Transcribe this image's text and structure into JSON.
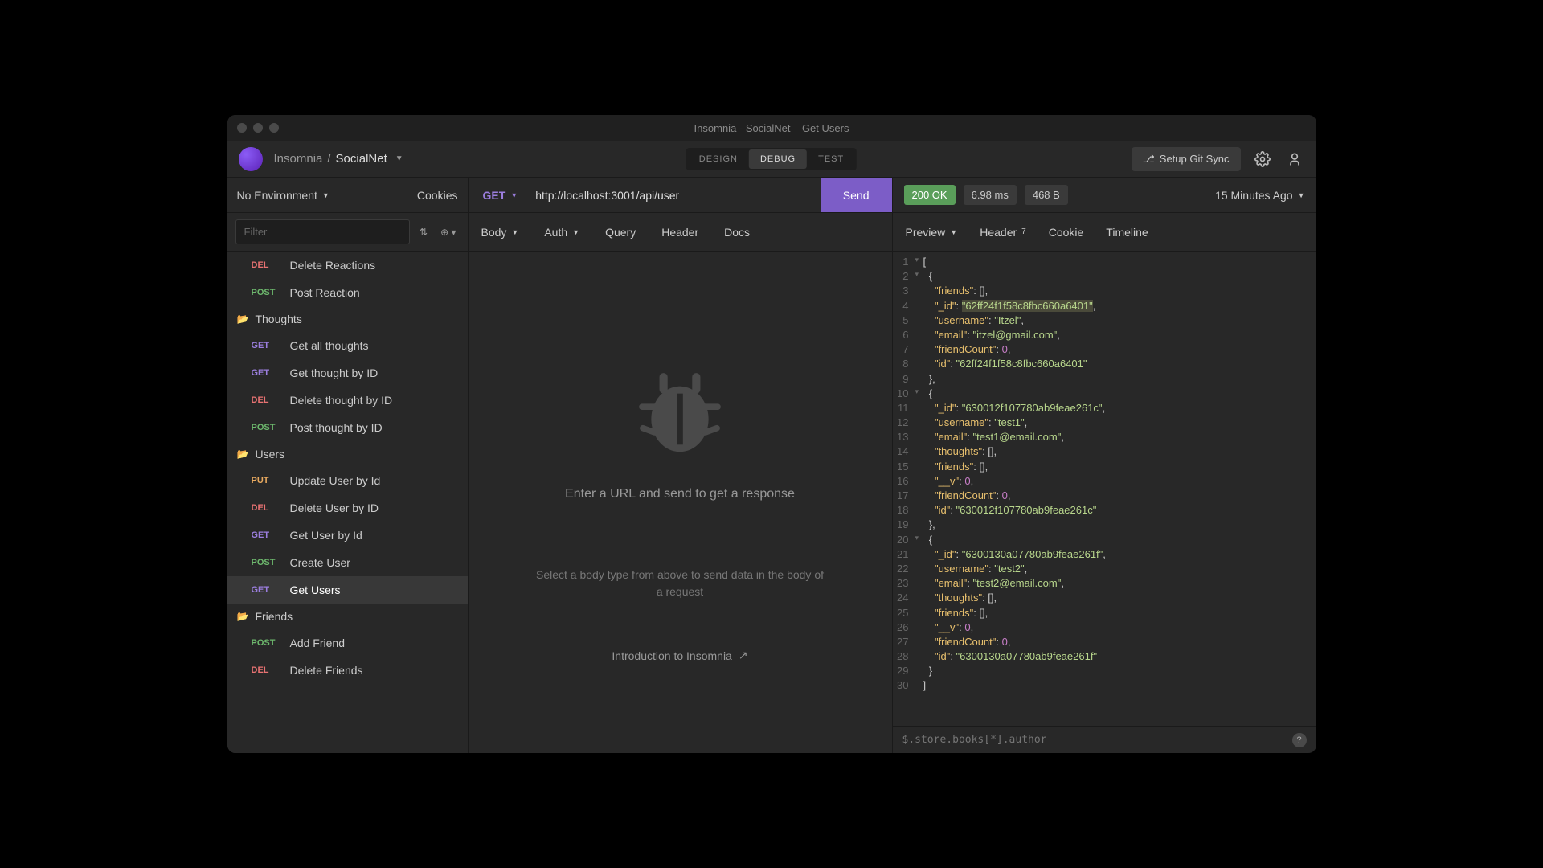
{
  "window_title": "Insomnia - SocialNet – Get Users",
  "breadcrumb": {
    "app": "Insomnia",
    "project": "SocialNet"
  },
  "modes": {
    "design": "DESIGN",
    "debug": "DEBUG",
    "test": "TEST"
  },
  "git_sync": "Setup Git Sync",
  "env_bar": {
    "env": "No Environment",
    "cookies": "Cookies"
  },
  "filter": {
    "placeholder": "Filter"
  },
  "sidebar": {
    "items": [
      {
        "type": "req",
        "method": "DEL",
        "name": "Delete Reactions"
      },
      {
        "type": "req",
        "method": "POST",
        "name": "Post Reaction"
      },
      {
        "type": "folder",
        "name": "Thoughts"
      },
      {
        "type": "req",
        "method": "GET",
        "name": "Get all thoughts"
      },
      {
        "type": "req",
        "method": "GET",
        "name": "Get thought by ID"
      },
      {
        "type": "req",
        "method": "DEL",
        "name": "Delete thought by ID"
      },
      {
        "type": "req",
        "method": "POST",
        "name": "Post thought by ID"
      },
      {
        "type": "folder",
        "name": "Users"
      },
      {
        "type": "req",
        "method": "PUT",
        "name": "Update User by Id"
      },
      {
        "type": "req",
        "method": "DEL",
        "name": "Delete User by ID"
      },
      {
        "type": "req",
        "method": "GET",
        "name": "Get User by Id"
      },
      {
        "type": "req",
        "method": "POST",
        "name": "Create User"
      },
      {
        "type": "req",
        "method": "GET",
        "name": "Get Users",
        "active": true
      },
      {
        "type": "folder",
        "name": "Friends"
      },
      {
        "type": "req",
        "method": "POST",
        "name": "Add Friend"
      },
      {
        "type": "req",
        "method": "DEL",
        "name": "Delete Friends"
      }
    ]
  },
  "request": {
    "method": "GET",
    "url": "http://localhost:3001/api/user",
    "send": "Send",
    "tabs": {
      "body": "Body",
      "auth": "Auth",
      "query": "Query",
      "header": "Header",
      "docs": "Docs"
    },
    "empty_msg": "Enter a URL and send to get a response",
    "body_hint": "Select a body type from above to send data in the body of a request",
    "intro": "Introduction to Insomnia"
  },
  "response": {
    "status": "200 OK",
    "time": "6.98 ms",
    "size": "468 B",
    "age": "15 Minutes Ago",
    "tabs": {
      "preview": "Preview",
      "header": "Header",
      "header_count": "7",
      "cookie": "Cookie",
      "timeline": "Timeline"
    },
    "json_lines": [
      {
        "n": 1,
        "fold": "▾",
        "tokens": [
          [
            "punc",
            "["
          ]
        ]
      },
      {
        "n": 2,
        "fold": "▾",
        "tokens": [
          [
            "punc",
            "  {"
          ]
        ]
      },
      {
        "n": 3,
        "tokens": [
          [
            "pad",
            "    "
          ],
          [
            "key",
            "\"friends\""
          ],
          [
            "punc",
            ": [],"
          ]
        ]
      },
      {
        "n": 4,
        "tokens": [
          [
            "pad",
            "    "
          ],
          [
            "key",
            "\"_id\""
          ],
          [
            "punc",
            ": "
          ],
          [
            "strH",
            "\"62ff24f1f58c8fbc660a6401\""
          ],
          [
            "punc",
            ","
          ]
        ]
      },
      {
        "n": 5,
        "tokens": [
          [
            "pad",
            "    "
          ],
          [
            "key",
            "\"username\""
          ],
          [
            "punc",
            ": "
          ],
          [
            "str",
            "\"Itzel\""
          ],
          [
            "punc",
            ","
          ]
        ]
      },
      {
        "n": 6,
        "tokens": [
          [
            "pad",
            "    "
          ],
          [
            "key",
            "\"email\""
          ],
          [
            "punc",
            ": "
          ],
          [
            "str",
            "\"itzel@gmail.com\""
          ],
          [
            "punc",
            ","
          ]
        ]
      },
      {
        "n": 7,
        "tokens": [
          [
            "pad",
            "    "
          ],
          [
            "key",
            "\"friendCount\""
          ],
          [
            "punc",
            ": "
          ],
          [
            "num",
            "0"
          ],
          [
            "punc",
            ","
          ]
        ]
      },
      {
        "n": 8,
        "tokens": [
          [
            "pad",
            "    "
          ],
          [
            "key",
            "\"id\""
          ],
          [
            "punc",
            ": "
          ],
          [
            "str",
            "\"62ff24f1f58c8fbc660a6401\""
          ]
        ]
      },
      {
        "n": 9,
        "tokens": [
          [
            "punc",
            "  },"
          ]
        ]
      },
      {
        "n": 10,
        "fold": "▾",
        "tokens": [
          [
            "punc",
            "  {"
          ]
        ]
      },
      {
        "n": 11,
        "tokens": [
          [
            "pad",
            "    "
          ],
          [
            "key",
            "\"_id\""
          ],
          [
            "punc",
            ": "
          ],
          [
            "str",
            "\"630012f107780ab9feae261c\""
          ],
          [
            "punc",
            ","
          ]
        ]
      },
      {
        "n": 12,
        "tokens": [
          [
            "pad",
            "    "
          ],
          [
            "key",
            "\"username\""
          ],
          [
            "punc",
            ": "
          ],
          [
            "str",
            "\"test1\""
          ],
          [
            "punc",
            ","
          ]
        ]
      },
      {
        "n": 13,
        "tokens": [
          [
            "pad",
            "    "
          ],
          [
            "key",
            "\"email\""
          ],
          [
            "punc",
            ": "
          ],
          [
            "str",
            "\"test1@email.com\""
          ],
          [
            "punc",
            ","
          ]
        ]
      },
      {
        "n": 14,
        "tokens": [
          [
            "pad",
            "    "
          ],
          [
            "key",
            "\"thoughts\""
          ],
          [
            "punc",
            ": [],"
          ]
        ]
      },
      {
        "n": 15,
        "tokens": [
          [
            "pad",
            "    "
          ],
          [
            "key",
            "\"friends\""
          ],
          [
            "punc",
            ": [],"
          ]
        ]
      },
      {
        "n": 16,
        "tokens": [
          [
            "pad",
            "    "
          ],
          [
            "key",
            "\"__v\""
          ],
          [
            "punc",
            ": "
          ],
          [
            "num",
            "0"
          ],
          [
            "punc",
            ","
          ]
        ]
      },
      {
        "n": 17,
        "tokens": [
          [
            "pad",
            "    "
          ],
          [
            "key",
            "\"friendCount\""
          ],
          [
            "punc",
            ": "
          ],
          [
            "num",
            "0"
          ],
          [
            "punc",
            ","
          ]
        ]
      },
      {
        "n": 18,
        "tokens": [
          [
            "pad",
            "    "
          ],
          [
            "key",
            "\"id\""
          ],
          [
            "punc",
            ": "
          ],
          [
            "str",
            "\"630012f107780ab9feae261c\""
          ]
        ]
      },
      {
        "n": 19,
        "tokens": [
          [
            "punc",
            "  },"
          ]
        ]
      },
      {
        "n": 20,
        "fold": "▾",
        "tokens": [
          [
            "punc",
            "  {"
          ]
        ]
      },
      {
        "n": 21,
        "tokens": [
          [
            "pad",
            "    "
          ],
          [
            "key",
            "\"_id\""
          ],
          [
            "punc",
            ": "
          ],
          [
            "str",
            "\"6300130a07780ab9feae261f\""
          ],
          [
            "punc",
            ","
          ]
        ]
      },
      {
        "n": 22,
        "tokens": [
          [
            "pad",
            "    "
          ],
          [
            "key",
            "\"username\""
          ],
          [
            "punc",
            ": "
          ],
          [
            "str",
            "\"test2\""
          ],
          [
            "punc",
            ","
          ]
        ]
      },
      {
        "n": 23,
        "tokens": [
          [
            "pad",
            "    "
          ],
          [
            "key",
            "\"email\""
          ],
          [
            "punc",
            ": "
          ],
          [
            "str",
            "\"test2@email.com\""
          ],
          [
            "punc",
            ","
          ]
        ]
      },
      {
        "n": 24,
        "tokens": [
          [
            "pad",
            "    "
          ],
          [
            "key",
            "\"thoughts\""
          ],
          [
            "punc",
            ": [],"
          ]
        ]
      },
      {
        "n": 25,
        "tokens": [
          [
            "pad",
            "    "
          ],
          [
            "key",
            "\"friends\""
          ],
          [
            "punc",
            ": [],"
          ]
        ]
      },
      {
        "n": 26,
        "tokens": [
          [
            "pad",
            "    "
          ],
          [
            "key",
            "\"__v\""
          ],
          [
            "punc",
            ": "
          ],
          [
            "num",
            "0"
          ],
          [
            "punc",
            ","
          ]
        ]
      },
      {
        "n": 27,
        "tokens": [
          [
            "pad",
            "    "
          ],
          [
            "key",
            "\"friendCount\""
          ],
          [
            "punc",
            ": "
          ],
          [
            "num",
            "0"
          ],
          [
            "punc",
            ","
          ]
        ]
      },
      {
        "n": 28,
        "tokens": [
          [
            "pad",
            "    "
          ],
          [
            "key",
            "\"id\""
          ],
          [
            "punc",
            ": "
          ],
          [
            "str",
            "\"6300130a07780ab9feae261f\""
          ]
        ]
      },
      {
        "n": 29,
        "tokens": [
          [
            "punc",
            "  }"
          ]
        ]
      },
      {
        "n": 30,
        "tokens": [
          [
            "punc",
            "]"
          ]
        ]
      }
    ],
    "jsonpath_placeholder": "$.store.books[*].author"
  }
}
